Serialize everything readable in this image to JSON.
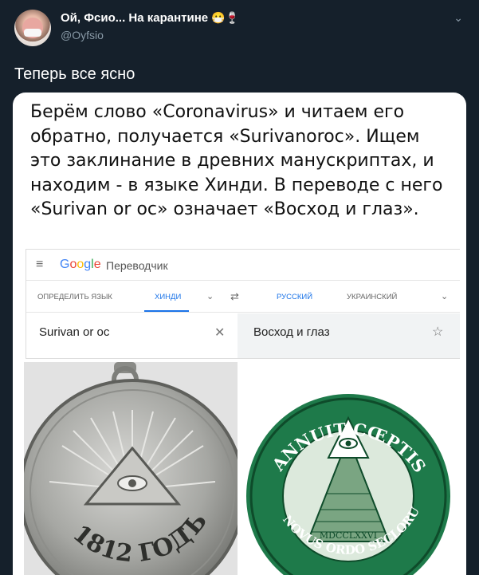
{
  "user": {
    "display_name": "Ой, Фсио... На карантине",
    "emoji": "😷🍷",
    "handle": "@Oyfsio"
  },
  "tweet": {
    "text": "Теперь все ясно"
  },
  "image": {
    "caption": "Берём слово «Coronavirus» и читаем его обратно, получается «Surivanoroc». Ищем это заклинание в древних манускриптах, и находим - в языке Хинди. В переводе с него «Surivan or oc» означает «Восход и глаз».",
    "translator": {
      "logo": [
        "G",
        "o",
        "o",
        "g",
        "l",
        "e"
      ],
      "title": "Переводчик",
      "lang_detect": "ОПРЕДЕЛИТЬ ЯЗЫК",
      "lang_hindi": "ХИНДИ",
      "lang_russian": "РУССКИЙ",
      "lang_ukrainian": "УКРАИНСКИЙ",
      "source_text": "Surivan or oc",
      "target_text": "Восход и глаз"
    },
    "medal_text": "1812 ГОДЪ",
    "seal_top": "ANNUIT CŒPTIS",
    "seal_bottom": "NOVUS ORDO SECLORUM",
    "seal_numeral": "MDCCLXXVI"
  }
}
